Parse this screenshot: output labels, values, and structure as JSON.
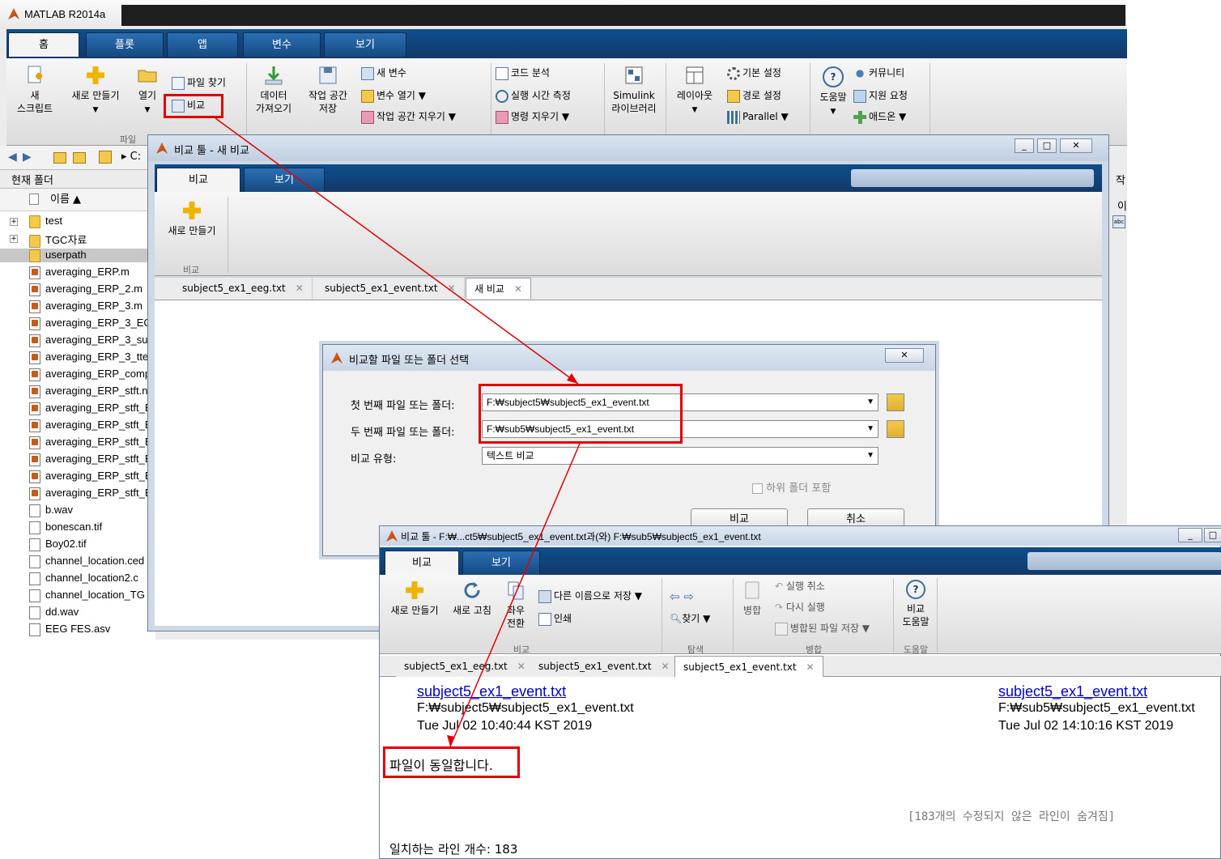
{
  "main_window": {
    "title": "MATLAB R2014a",
    "tabs": [
      "홈",
      "플롯",
      "앱",
      "변수",
      "보기"
    ],
    "ribbon": {
      "new_script": "새\n스크립트",
      "new": "새로 만들기",
      "open": "열기",
      "find_files": "파일 찾기",
      "compare": "비교",
      "file_group": "파일",
      "import_data": "데이터\n가져오기",
      "save_workspace": "작업 공간\n저장",
      "new_variable": "새 변수",
      "open_variable": "변수 열기",
      "clear_workspace": "작업 공간 지우기",
      "analyze_code": "코드 분석",
      "run_time": "실행 시간 측정",
      "clear_commands": "명령 지우기",
      "simulink": "Simulink\n라이브러리",
      "layout": "레이아웃",
      "preferences": "기본 설정",
      "set_path": "경로 설정",
      "parallel": "Parallel",
      "help": "도움말",
      "community": "커뮤니티",
      "request_support": "지원 요청",
      "addons": "애드온"
    },
    "address": "C:",
    "current_folder_label": "현재 폴더",
    "name_header": "이름 ▲",
    "files": [
      {
        "name": "test",
        "type": "folder"
      },
      {
        "name": "TGC자료",
        "type": "folder"
      },
      {
        "name": "userpath",
        "type": "folder"
      },
      {
        "name": "averaging_ERP.m",
        "type": "m"
      },
      {
        "name": "averaging_ERP_2.m",
        "type": "m"
      },
      {
        "name": "averaging_ERP_3.m",
        "type": "m"
      },
      {
        "name": "averaging_ERP_3_EC",
        "type": "m"
      },
      {
        "name": "averaging_ERP_3_sul",
        "type": "m"
      },
      {
        "name": "averaging_ERP_3_tte",
        "type": "m"
      },
      {
        "name": "averaging_ERP_comp",
        "type": "m"
      },
      {
        "name": "averaging_ERP_stft.n",
        "type": "m"
      },
      {
        "name": "averaging_ERP_stft_E",
        "type": "m"
      },
      {
        "name": "averaging_ERP_stft_E",
        "type": "m"
      },
      {
        "name": "averaging_ERP_stft_E",
        "type": "m"
      },
      {
        "name": "averaging_ERP_stft_E",
        "type": "m"
      },
      {
        "name": "averaging_ERP_stft_E",
        "type": "m"
      },
      {
        "name": "averaging_ERP_stft_E",
        "type": "m"
      },
      {
        "name": "b.wav",
        "type": "wav"
      },
      {
        "name": "bonescan.tif",
        "type": "tif"
      },
      {
        "name": "Boy02.tif",
        "type": "tif"
      },
      {
        "name": "channel_location.ced",
        "type": "file"
      },
      {
        "name": "channel_location2.c",
        "type": "file"
      },
      {
        "name": "channel_location_TG",
        "type": "file"
      },
      {
        "name": "dd.wav",
        "type": "wav"
      },
      {
        "name": "EEG FES.asv",
        "type": "asv"
      }
    ],
    "right_panel_label": "작",
    "right_panel_label2": "이"
  },
  "compare_tool": {
    "title": "비교 툴 - 새 비교",
    "tabs": [
      "비교",
      "보기"
    ],
    "new_button": "새로 만들기",
    "group_label": "비교",
    "doc_tabs": [
      "subject5_ex1_eeg.txt",
      "subject5_ex1_event.txt",
      "새 비교"
    ]
  },
  "select_dialog": {
    "title": "비교할 파일 또는 폴더 선택",
    "first_label": "첫 번째 파일 또는 폴더:",
    "first_value": "F:₩subject5₩subject5_ex1_event.txt",
    "second_label": "두 번째 파일 또는 폴더:",
    "second_value": "F:₩sub5₩subject5_ex1_event.txt",
    "type_label": "비교 유형:",
    "type_value": "텍스트 비교",
    "include_subfolders": "하위 폴더 포함",
    "compare_button": "비교",
    "cancel_button": "취소"
  },
  "result_window": {
    "title": "비교 툴 - F:₩...ct5₩subject5_ex1_event.txt과(와) F:₩sub5₩subject5_ex1_event.txt",
    "tabs": [
      "비교",
      "보기"
    ],
    "new": "새로 만들기",
    "refresh": "새로 고침",
    "swap": "좌우\n전환",
    "save_as": "다른 이름으로 저장",
    "print": "인쇄",
    "find": "찾기",
    "merge": "병합",
    "undo": "실행 취소",
    "redo": "다시 실행",
    "save_merged": "병합된 파일 저장",
    "compare_help": "비교\n도움말",
    "groups": [
      "비교",
      "탐색",
      "병합",
      "도움말"
    ],
    "doc_tabs": [
      "subject5_ex1_eeg.txt",
      "subject5_ex1_event.txt",
      "subject5_ex1_event.txt"
    ],
    "left_file": {
      "name": "subject5_ex1_event.txt",
      "path": "F:₩subject5₩subject5_ex1_event.txt",
      "date": "Tue Jul 02 10:40:44 KST 2019"
    },
    "right_file": {
      "name": "subject5_ex1_event.txt",
      "path": "F:₩sub5₩subject5_ex1_event.txt",
      "date": "Tue Jul 02 14:10:16 KST 2019"
    },
    "identical_message": "파일이 동일합니다.",
    "hidden_lines": "[183개의 수정되지 않은 라인이 숨겨짐]",
    "matching_lines": "일치하는 라인 개수: 183"
  },
  "colors": {
    "highlight": "#e00000",
    "tab_blue": "#164a82",
    "arrow": "#e00000"
  }
}
